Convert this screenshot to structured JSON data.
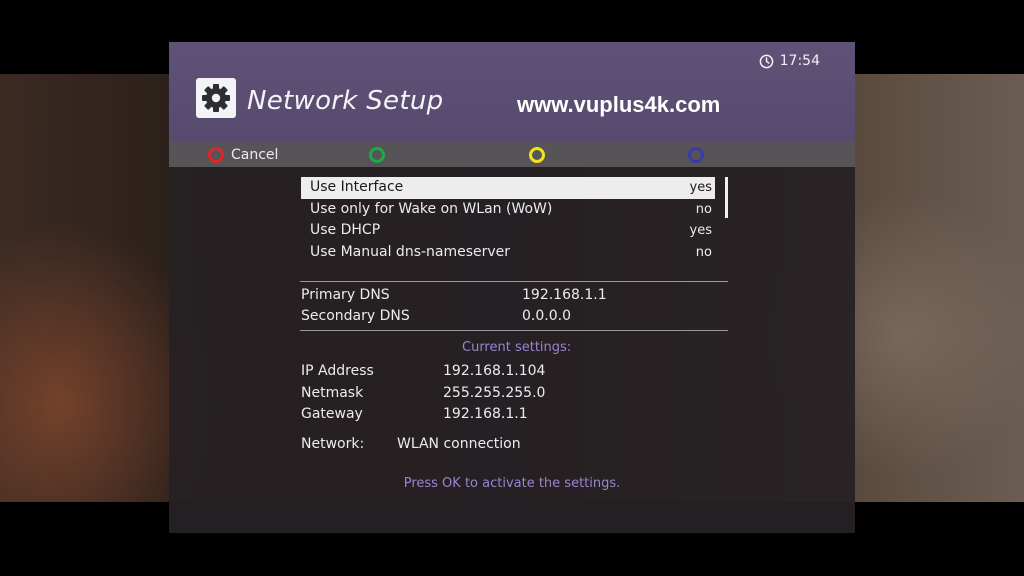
{
  "clock": {
    "time": "17:54",
    "icon": "clock-icon"
  },
  "header": {
    "title": "Network Setup",
    "icon": "gear-icon",
    "watermark": "www.vuplus4k.com"
  },
  "color_buttons": {
    "red": "Cancel",
    "green": "",
    "yellow": "",
    "blue": "",
    "colors": {
      "red": "#e0252a",
      "green": "#1da84a",
      "yellow": "#f2e21c",
      "blue": "#3b3bb0"
    }
  },
  "config_list": [
    {
      "label": "Use Interface",
      "value": "yes",
      "selected": true
    },
    {
      "label": "Use only for Wake on WLan (WoW)",
      "value": "no",
      "selected": false
    },
    {
      "label": "Use DHCP",
      "value": "yes",
      "selected": false
    },
    {
      "label": "Use Manual dns-nameserver",
      "value": "no",
      "selected": false
    }
  ],
  "dns": {
    "primary_label": "Primary DNS",
    "primary_value": "192.168.1.1",
    "secondary_label": "Secondary DNS",
    "secondary_value": "0.0.0.0"
  },
  "current": {
    "heading": "Current settings:",
    "ip_label": "IP Address",
    "ip_value": "192.168.1.104",
    "netmask_label": "Netmask",
    "netmask_value": "255.255.255.0",
    "gateway_label": "Gateway",
    "gateway_value": "192.168.1.1",
    "network_label": "Network:",
    "network_value": "WLAN connection"
  },
  "hint": "Press OK to activate the settings."
}
